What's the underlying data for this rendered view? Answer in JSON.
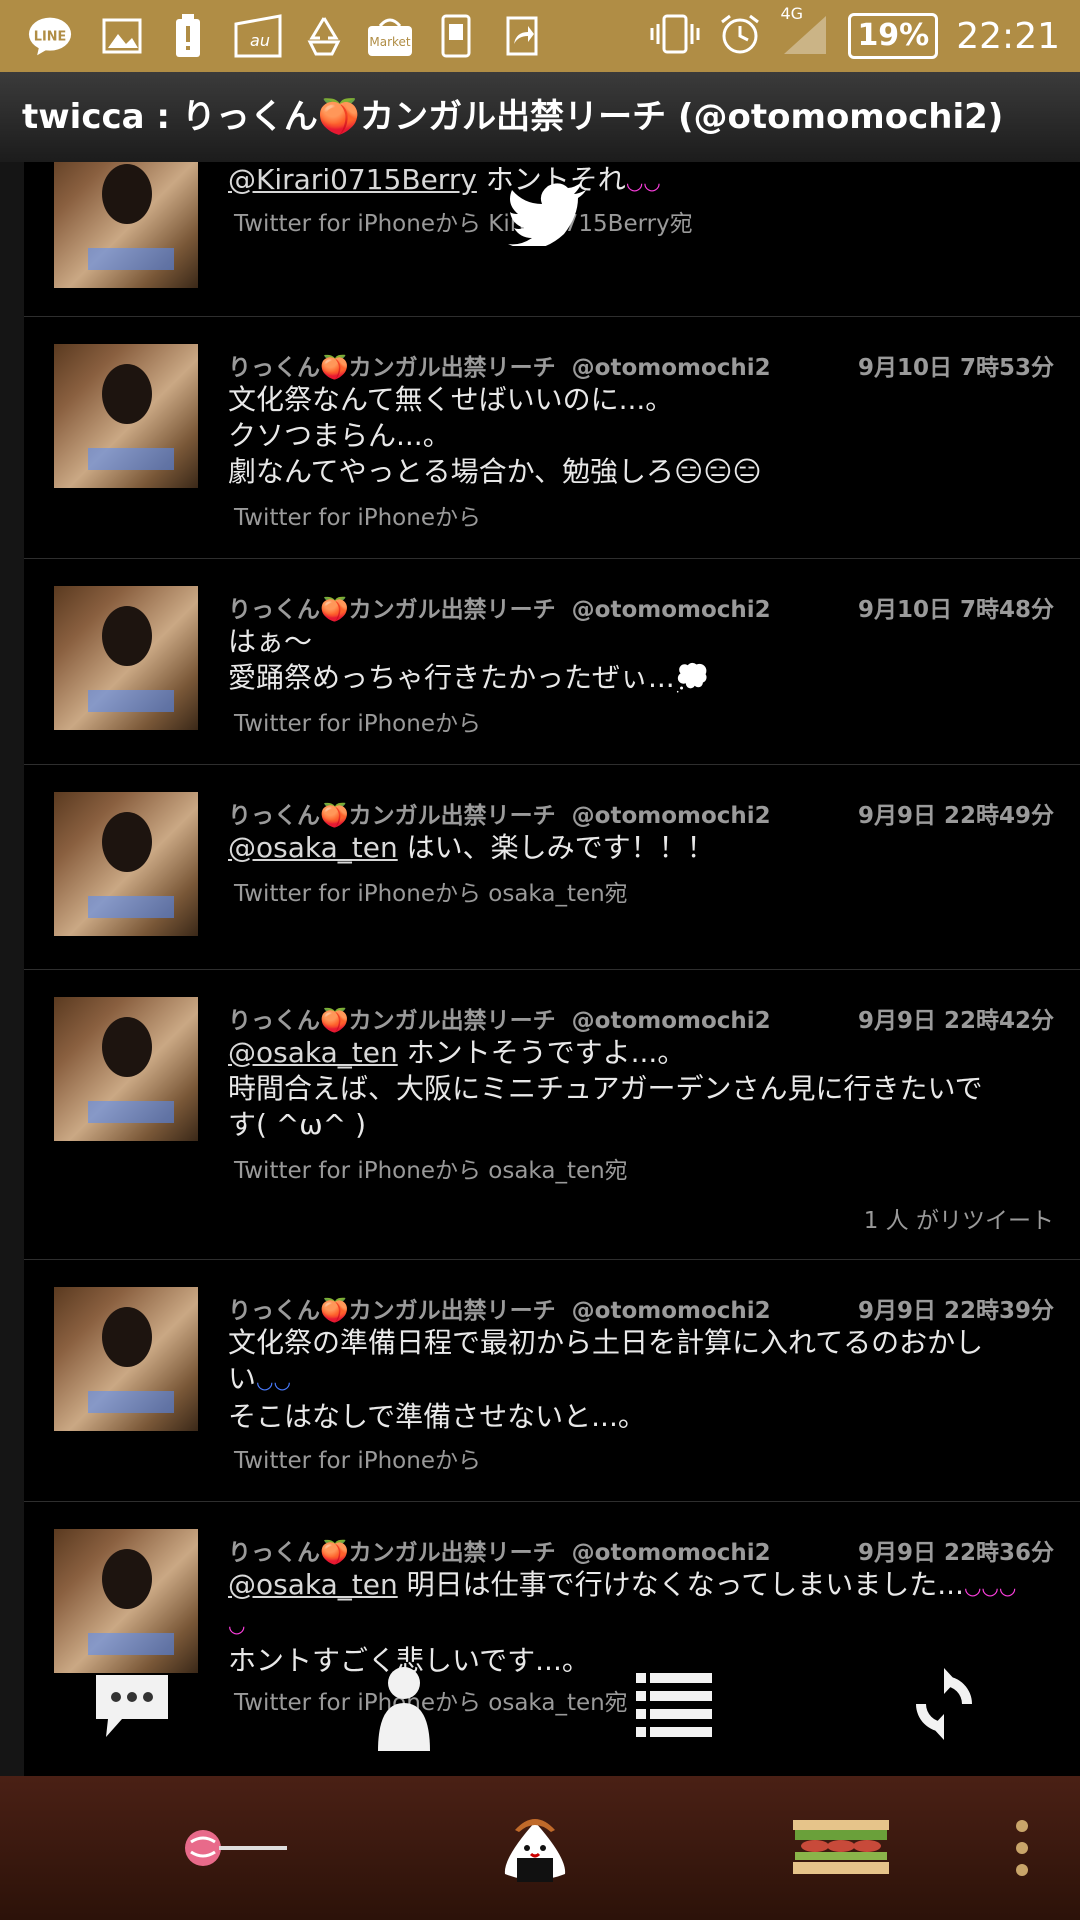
{
  "status_bar": {
    "line_label": "LINE",
    "au_label": "au",
    "market_label": "Market",
    "network": "4G",
    "battery": "19%",
    "time": "22:21"
  },
  "title": "twicca : りっくん🍑カンガル出禁リーチ (@otomomochi2)",
  "tweets": [
    {
      "author": "",
      "handle": "",
      "date": "",
      "lines": [
        [
          "@Kirari0715Berry",
          " ホントそれ"
        ]
      ],
      "source": "Twitter for iPhoneから Kirari0715Berry宛"
    },
    {
      "author": "りっくん🍑カンガル出禁リーチ",
      "handle": "@otomomochi2",
      "date": "9月10日 7時53分",
      "lines": [
        "文化祭なんて無くせばいいのに...。",
        "クソつまらん...。",
        "劇なんてやっとる場合か、勉強しろ😑😑😑"
      ],
      "source": "Twitter for iPhoneから"
    },
    {
      "author": "りっくん🍑カンガル出禁リーチ",
      "handle": "@otomomochi2",
      "date": "9月10日 7時48分",
      "lines": [
        "はぁ〜",
        "愛踊祭めっちゃ行きたかったぜぃ...💭"
      ],
      "source": "Twitter for iPhoneから"
    },
    {
      "author": "りっくん🍑カンガル出禁リーチ",
      "handle": "@otomomochi2",
      "date": "9月9日 22時49分",
      "mention": "@osaka_ten",
      "lines": [
        " はい、楽しみです！！！"
      ],
      "source": "Twitter for iPhoneから osaka_ten宛"
    },
    {
      "author": "りっくん🍑カンガル出禁リーチ",
      "handle": "@otomomochi2",
      "date": "9月9日 22時42分",
      "mention": "@osaka_ten",
      "lines": [
        " ホントそうですよ...。",
        "時間合えば、大阪にミニチュアガーデンさん見に行きたいで",
        "す( ^ω^ )"
      ],
      "source": "Twitter for iPhoneから osaka_ten宛",
      "retweet": "1 人 がリツイート"
    },
    {
      "author": "りっくん🍑カンガル出禁リーチ",
      "handle": "@otomomochi2",
      "date": "9月9日 22時39分",
      "lines": [
        "文化祭の準備日程で最初から土日を計算に入れてるのおかし",
        "い",
        "そこはなしで準備させないと...。"
      ],
      "source": "Twitter for iPhoneから"
    },
    {
      "author": "りっくん🍑カンガル出禁リーチ",
      "handle": "@otomomochi2",
      "date": "9月9日 22時36分",
      "mention": "@osaka_ten",
      "lines": [
        " 明日は仕事で行けなくなってしまいました...",
        "",
        "ホントすごく悲しいです...。"
      ],
      "source": "Twitter for iPhoneから osaka_ten宛"
    }
  ],
  "icons": {
    "twitter_overlay": "twitter-bird-icon",
    "compose": "speech-bubble-icon",
    "profile": "person-icon",
    "lists": "list-icon",
    "refresh": "refresh-icon",
    "tab1": "lollipop-icon",
    "tab2": "onigiri-icon",
    "tab3": "sandwich-icon",
    "overflow": "more-vertical-icon"
  },
  "colors": {
    "status_bar": "#b08d45",
    "bottom_bar": "#3a170d",
    "background": "#000000"
  }
}
